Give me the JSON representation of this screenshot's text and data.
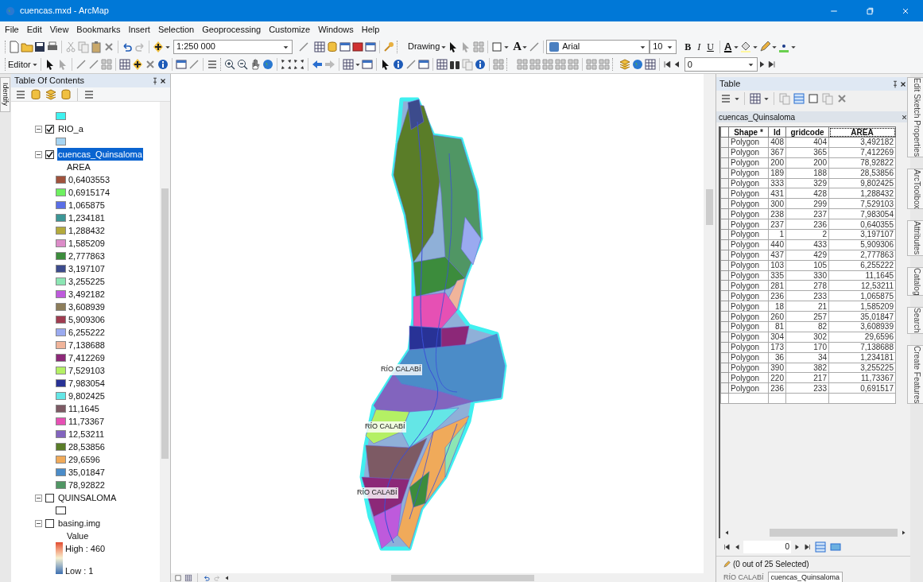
{
  "window": {
    "title": "cuencas.mxd - ArcMap"
  },
  "menu": [
    "File",
    "Edit",
    "View",
    "Bookmarks",
    "Insert",
    "Selection",
    "Geoprocessing",
    "Customize",
    "Windows",
    "Help"
  ],
  "toolbar": {
    "scale": "1:250 000",
    "drawing": "Drawing",
    "text_tool": "A",
    "font": "Arial",
    "font_size": "10",
    "bold": "B",
    "italic": "I",
    "underline": "U",
    "font_color": "A",
    "editor": "Editor",
    "georef_value": "0"
  },
  "left_dock": [
    "Identify"
  ],
  "toc": {
    "title": "Table Of Contents",
    "layers": [
      {
        "legend": [
          {
            "color": "#3ef2f0"
          }
        ]
      },
      {
        "name": "RIO_a",
        "checked": true,
        "expanded": true,
        "selected": false,
        "legend": [
          {
            "color": "#a6d4f2"
          }
        ]
      },
      {
        "name": "cuencas_Quinsaloma",
        "checked": true,
        "expanded": true,
        "selected": true,
        "field": "AREA",
        "legend": [
          {
            "label": "0,6403553",
            "color": "#a0523c"
          },
          {
            "label": "0,6915174",
            "color": "#6ef060"
          },
          {
            "label": "1,065875",
            "color": "#5a6ee6"
          },
          {
            "label": "1,234181",
            "color": "#3c9696"
          },
          {
            "label": "1,288432",
            "color": "#b4aa3c"
          },
          {
            "label": "1,585209",
            "color": "#dc8cc8"
          },
          {
            "label": "2,777863",
            "color": "#3c8c3c"
          },
          {
            "label": "3,197107",
            "color": "#3c4b8c"
          },
          {
            "label": "3,255225",
            "color": "#8ce6b4"
          },
          {
            "label": "3,492182",
            "color": "#be5adc"
          },
          {
            "label": "3,608939",
            "color": "#8c7d5a"
          },
          {
            "label": "5,909306",
            "color": "#a03c50"
          },
          {
            "label": "6,255222",
            "color": "#9aaaf0"
          },
          {
            "label": "7,138688",
            "color": "#f0b49a"
          },
          {
            "label": "7,412269",
            "color": "#8c2878"
          },
          {
            "label": "7,529103",
            "color": "#b4f064"
          },
          {
            "label": "7,983054",
            "color": "#283296"
          },
          {
            "label": "9,802425",
            "color": "#64e6e6"
          },
          {
            "label": "11,1645",
            "color": "#7d5a64"
          },
          {
            "label": "11,73367",
            "color": "#e650b4"
          },
          {
            "label": "12,53211",
            "color": "#8264be"
          },
          {
            "label": "28,53856",
            "color": "#5a7d28"
          },
          {
            "label": "29,6596",
            "color": "#f0aa5a"
          },
          {
            "label": "35,01847",
            "color": "#4b8cc8"
          },
          {
            "label": "78,92822",
            "color": "#509664"
          }
        ]
      },
      {
        "name": "QUINSALOMA",
        "checked": false,
        "expanded": true,
        "selected": false,
        "legend": [
          {
            "color": "#ffffff"
          }
        ]
      },
      {
        "name": "basing.img",
        "checked": false,
        "expanded": true,
        "selected": false,
        "field": "Value",
        "ramp": {
          "high": "High : 460",
          "low": "Low : 1"
        }
      }
    ]
  },
  "map": {
    "labels": [
      "RÍO CALABÍ",
      "RÍO CALABÍ",
      "RÍO CALABÍ"
    ]
  },
  "table": {
    "title": "Table",
    "layer": "cuencas_Quinsaloma",
    "columns": [
      "Shape *",
      "Id",
      "gridcode",
      "AREA"
    ],
    "rows": [
      [
        "Polygon",
        "408",
        "404",
        "3,492182"
      ],
      [
        "Polygon",
        "367",
        "365",
        "7,412269"
      ],
      [
        "Polygon",
        "200",
        "200",
        "78,92822"
      ],
      [
        "Polygon",
        "189",
        "188",
        "28,53856"
      ],
      [
        "Polygon",
        "333",
        "329",
        "9,802425"
      ],
      [
        "Polygon",
        "431",
        "428",
        "1,288432"
      ],
      [
        "Polygon",
        "300",
        "299",
        "7,529103"
      ],
      [
        "Polygon",
        "238",
        "237",
        "7,983054"
      ],
      [
        "Polygon",
        "237",
        "236",
        "0,640355"
      ],
      [
        "Polygon",
        "1",
        "2",
        "3,197107"
      ],
      [
        "Polygon",
        "440",
        "433",
        "5,909306"
      ],
      [
        "Polygon",
        "437",
        "429",
        "2,777863"
      ],
      [
        "Polygon",
        "103",
        "105",
        "6,255222"
      ],
      [
        "Polygon",
        "335",
        "330",
        "11,1645"
      ],
      [
        "Polygon",
        "281",
        "278",
        "12,53211"
      ],
      [
        "Polygon",
        "236",
        "233",
        "1,065875"
      ],
      [
        "Polygon",
        "18",
        "21",
        "1,585209"
      ],
      [
        "Polygon",
        "260",
        "257",
        "35,01847"
      ],
      [
        "Polygon",
        "81",
        "82",
        "3,608939"
      ],
      [
        "Polygon",
        "304",
        "302",
        "29,6596"
      ],
      [
        "Polygon",
        "173",
        "170",
        "7,138688"
      ],
      [
        "Polygon",
        "36",
        "34",
        "1,234181"
      ],
      [
        "Polygon",
        "390",
        "382",
        "3,255225"
      ],
      [
        "Polygon",
        "220",
        "217",
        "11,73367"
      ],
      [
        "Polygon",
        "236",
        "233",
        "0,691517"
      ]
    ],
    "record": "0",
    "selection": "(0 out of 25 Selected)",
    "tabs": [
      {
        "label": "RÍO CALABÍ",
        "selected": false
      },
      {
        "label": "cuencas_Quinsaloma",
        "selected": true
      }
    ]
  },
  "right_dock": [
    "Edit Sketch Properties",
    "ArcToolbox",
    "Attributes",
    "Catalog",
    "Search",
    "Create Features"
  ]
}
